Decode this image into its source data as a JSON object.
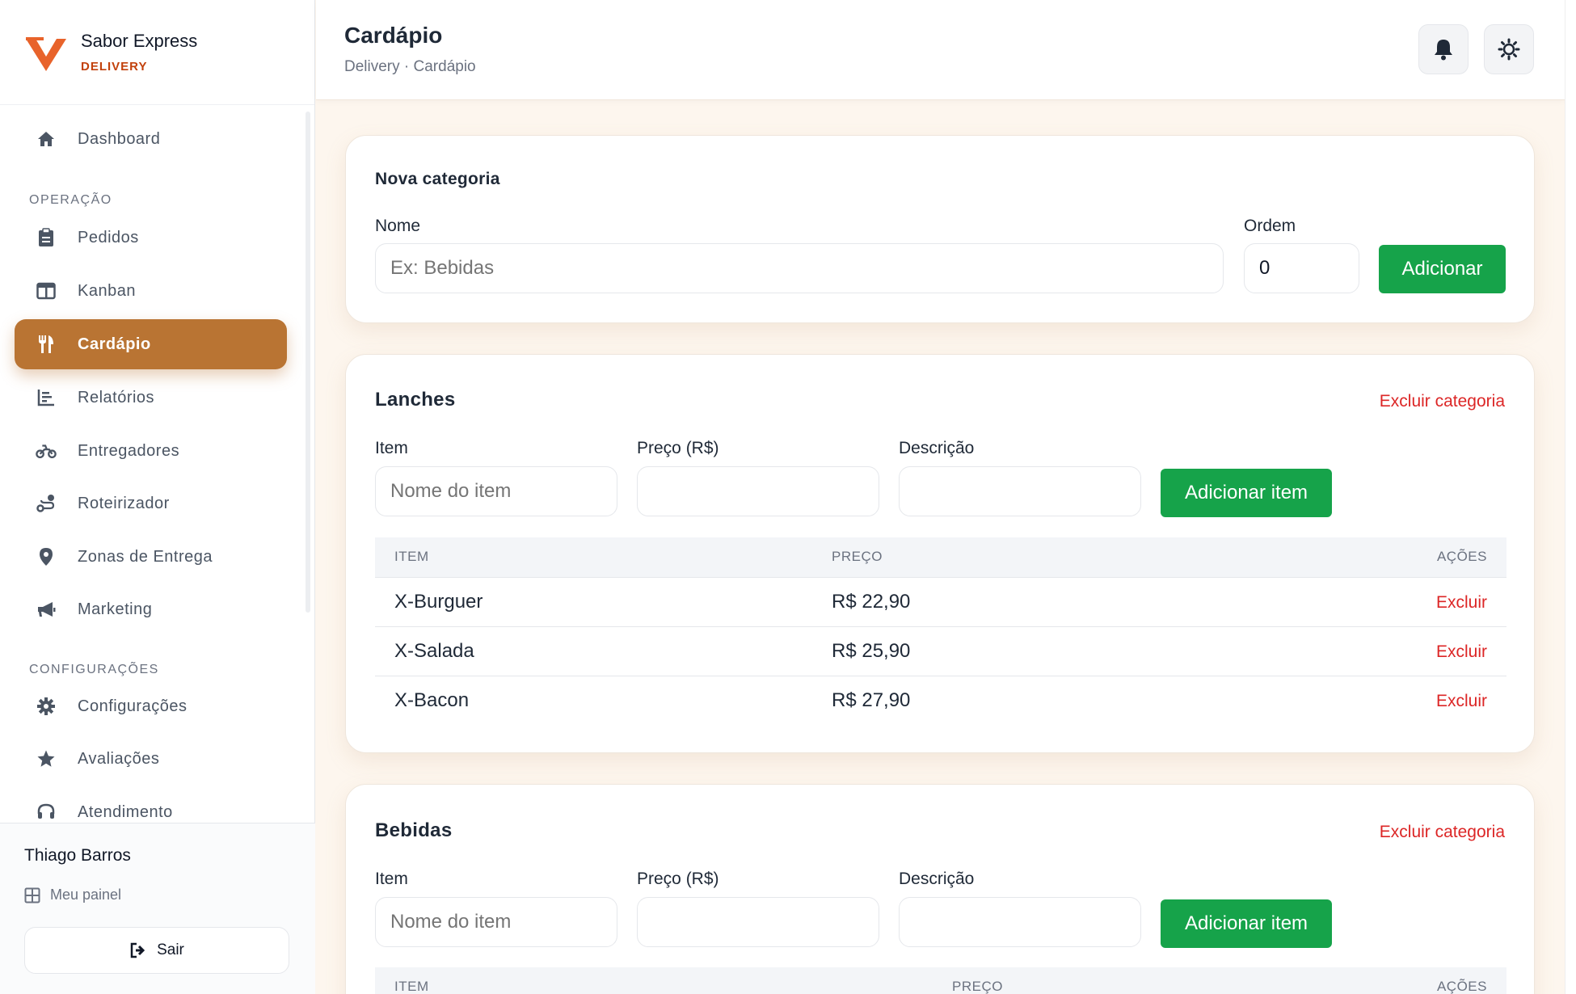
{
  "brand": {
    "name": "Sabor Express",
    "sub": "DELIVERY",
    "accent": "#e8632b"
  },
  "sidebar": {
    "items": [
      {
        "label": "Dashboard",
        "icon": "home-icon"
      },
      {
        "label": "Pedidos",
        "icon": "clipboard-icon"
      },
      {
        "label": "Kanban",
        "icon": "columns-icon"
      },
      {
        "label": "Cardápio",
        "icon": "utensils-icon",
        "active": true
      },
      {
        "label": "Relatórios",
        "icon": "chart-icon"
      },
      {
        "label": "Entregadores",
        "icon": "motorcycle-icon"
      },
      {
        "label": "Roteirizador",
        "icon": "route-icon"
      },
      {
        "label": "Zonas de Entrega",
        "icon": "map-pin-icon"
      },
      {
        "label": "Marketing",
        "icon": "megaphone-icon"
      },
      {
        "label": "Configurações",
        "icon": "gear-icon"
      },
      {
        "label": "Avaliações",
        "icon": "star-icon"
      },
      {
        "label": "Atendimento",
        "icon": "headset-icon"
      }
    ],
    "sections": {
      "operation": "OPERAÇÃO",
      "settings": "CONFIGURAÇÕES"
    },
    "active_color": "#b97433"
  },
  "user": {
    "name": "Thiago Barros",
    "panel_label": "Meu painel",
    "logout_label": "Sair"
  },
  "header": {
    "title": "Cardápio",
    "breadcrumb": "Delivery · Cardápio"
  },
  "new_category": {
    "title": "Nova categoria",
    "name_label": "Nome",
    "name_placeholder": "Ex: Bebidas",
    "order_label": "Ordem",
    "order_value": "0",
    "add_label": "Adicionar"
  },
  "categories": [
    {
      "title": "Lanches",
      "delete_label": "Excluir categoria",
      "item_label": "Item",
      "price_label": "Preço (R$)",
      "description_label": "Descrição",
      "item_placeholder": "Nome do item",
      "add_item_label": "Adicionar item",
      "columns": [
        "ITEM",
        "PREÇO",
        "AÇÕES"
      ],
      "rows": [
        {
          "item": "X-Burguer",
          "price": "R$ 22,90",
          "action": "Excluir"
        },
        {
          "item": "X-Salada",
          "price": "R$ 25,90",
          "action": "Excluir"
        },
        {
          "item": "X-Bacon",
          "price": "R$ 27,90",
          "action": "Excluir"
        }
      ]
    },
    {
      "title": "Bebidas",
      "delete_label": "Excluir categoria",
      "item_label": "Item",
      "price_label": "Preço (R$)",
      "description_label": "Descrição",
      "item_placeholder": "Nome do item",
      "add_item_label": "Adicionar item",
      "columns": [
        "ITEM",
        "PREÇO",
        "AÇÕES"
      ]
    }
  ],
  "colors": {
    "green": "#16a34a",
    "red": "#dc2626"
  }
}
